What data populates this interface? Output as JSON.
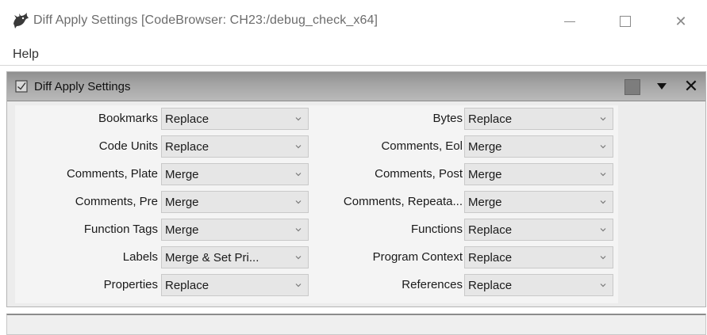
{
  "window": {
    "title": "Diff Apply Settings [CodeBrowser: CH23:/debug_check_x64]",
    "app_icon": "ghidra-dragon-icon",
    "minimize_glyph": "—",
    "maximize_glyph": "☐",
    "close_glyph": "✕"
  },
  "menu": {
    "items": [
      {
        "label": "Help"
      }
    ]
  },
  "panel": {
    "title": "Diff Apply Settings",
    "header_icons": [
      "checkbox-icon",
      "snapshot-icon",
      "dropdown-triangle-icon",
      "close-icon"
    ],
    "close_glyph": "✕"
  },
  "settings": {
    "left": [
      {
        "label": "Bookmarks",
        "value": "Replace"
      },
      {
        "label": "Code Units",
        "value": "Replace"
      },
      {
        "label": "Comments, Plate",
        "value": "Merge"
      },
      {
        "label": "Comments, Pre",
        "value": "Merge"
      },
      {
        "label": "Function Tags",
        "value": "Merge"
      },
      {
        "label": "Labels",
        "value": "Merge & Set Pri..."
      },
      {
        "label": "Properties",
        "value": "Replace"
      }
    ],
    "right": [
      {
        "label": "Bytes",
        "value": "Replace"
      },
      {
        "label": "Comments, Eol",
        "value": "Merge"
      },
      {
        "label": "Comments, Post",
        "value": "Merge"
      },
      {
        "label": "Comments, Repeata...",
        "value": "Merge"
      },
      {
        "label": "Functions",
        "value": "Replace"
      },
      {
        "label": "Program Context",
        "value": "Replace"
      },
      {
        "label": "References",
        "value": "Replace"
      }
    ]
  },
  "colors": {
    "header_gradient_top": "#8f8f8f",
    "header_gradient_bottom": "#b9b9b9",
    "combo_bg": "#e6e6e6"
  }
}
